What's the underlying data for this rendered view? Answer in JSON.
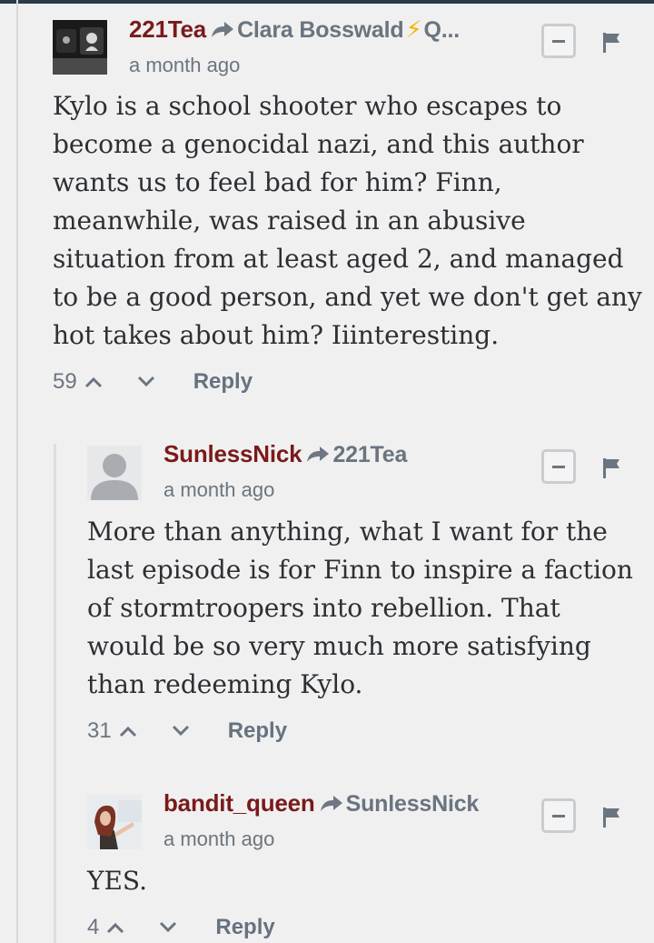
{
  "comments": [
    {
      "author": "221Tea",
      "reply_to": "Clara Bosswald",
      "reply_to_suffix": "Q...",
      "time": "a month ago",
      "body": "Kylo is a school shooter who escapes to become a genocidal nazi, and this author wants us to feel bad for him? Finn, meanwhile, was raised in an abusive situation from at least aged 2, and managed to be a good person, and yet we don't get any hot takes about him? Iiinteresting.",
      "votes": "59",
      "reply_label": "Reply"
    },
    {
      "author": "SunlessNick",
      "reply_to": "221Tea",
      "time": "a month ago",
      "body": "More than anything, what I want for the last episode is for Finn to inspire a faction of stormtroopers into rebellion. That would be so very much more satisfying than redeeming Kylo.",
      "votes": "31",
      "reply_label": "Reply"
    },
    {
      "author": "bandit_queen",
      "reply_to": "SunlessNick",
      "time": "a month ago",
      "body": "YES.",
      "votes": "4",
      "reply_label": "Reply"
    }
  ],
  "icons": {
    "bolt": "⚡",
    "reply_arrow": "reply-arrow-icon",
    "collapse": "minus-icon",
    "flag": "flag-icon",
    "upvote": "chevron-up-icon",
    "downvote": "chevron-down-icon"
  },
  "colors": {
    "author": "#7a1a1a",
    "meta": "#6b7580",
    "background": "#f0f0f0"
  }
}
